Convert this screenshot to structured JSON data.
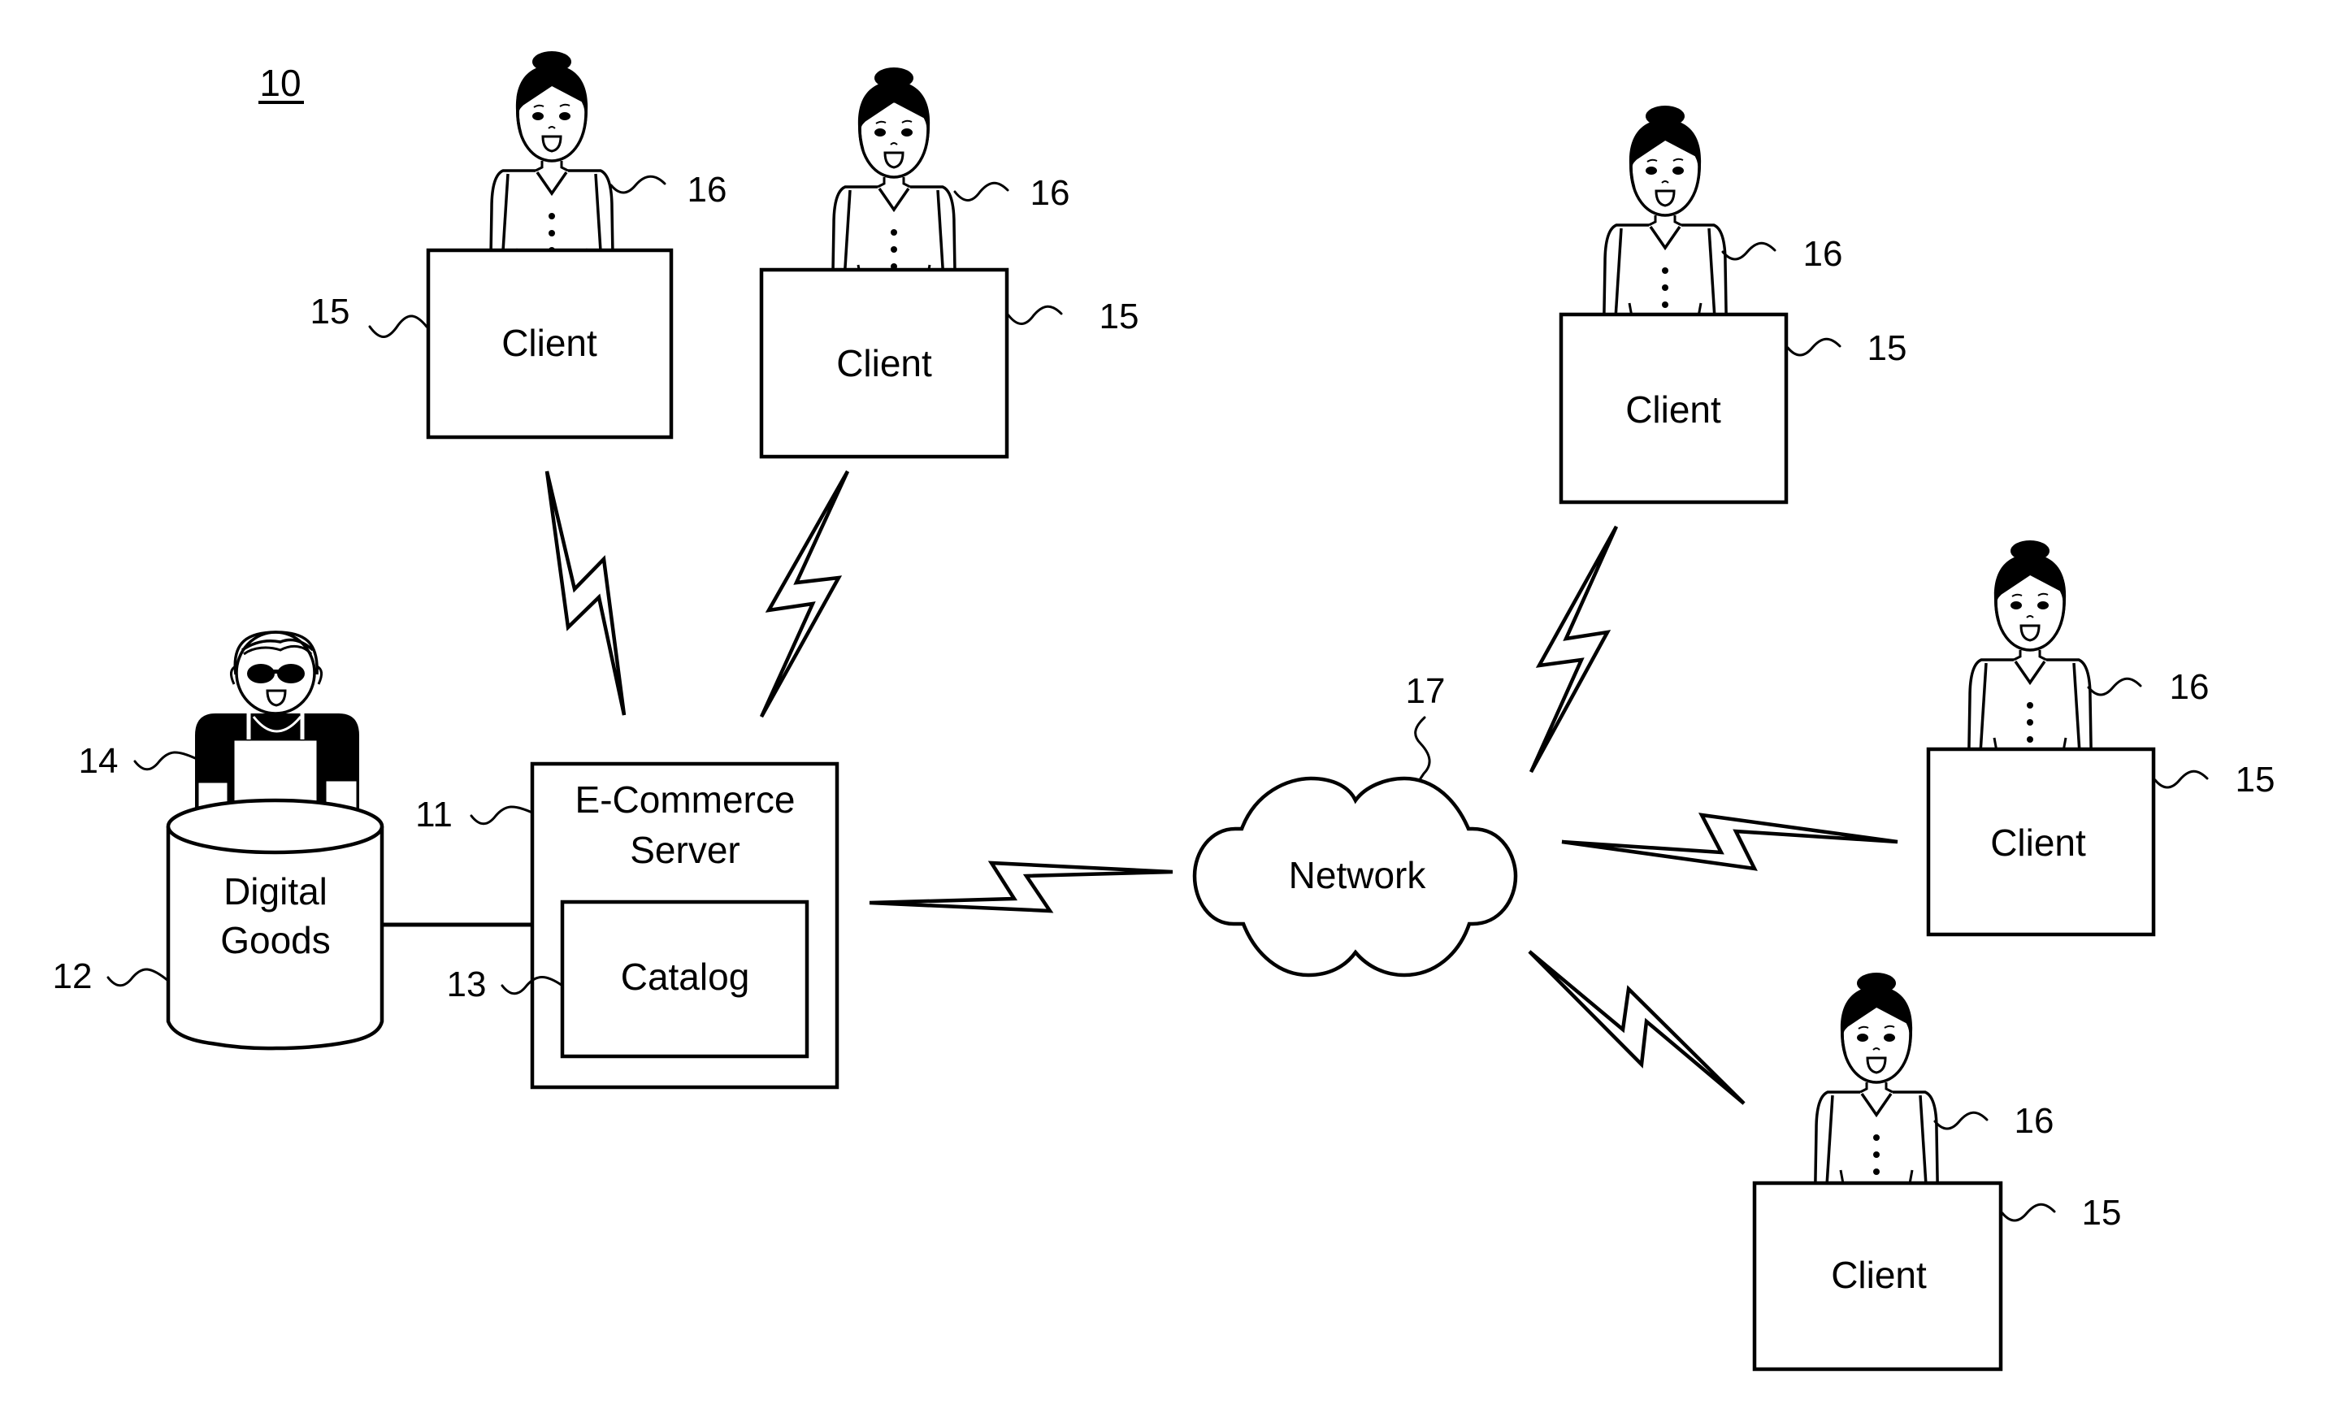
{
  "figure": {
    "number": "10",
    "nodes": {
      "server": {
        "title_line1": "E-Commerce",
        "title_line2": "Server",
        "ref": "11"
      },
      "catalog": {
        "label": "Catalog",
        "ref": "13"
      },
      "storage": {
        "label_line1": "Digital",
        "label_line2": "Goods",
        "ref": "12"
      },
      "merchant": {
        "ref": "14"
      },
      "network": {
        "label": "Network",
        "ref": "17"
      }
    },
    "clients": [
      {
        "label": "Client",
        "box_ref": "15",
        "user_ref": "16"
      },
      {
        "label": "Client",
        "box_ref": "15",
        "user_ref": "16"
      },
      {
        "label": "Client",
        "box_ref": "15",
        "user_ref": "16"
      },
      {
        "label": "Client",
        "box_ref": "15",
        "user_ref": "16"
      },
      {
        "label": "Client",
        "box_ref": "15",
        "user_ref": "16"
      }
    ],
    "connections": [
      {
        "from": "clients.0",
        "to": "server",
        "type": "wireless"
      },
      {
        "from": "clients.1",
        "to": "server",
        "type": "wireless"
      },
      {
        "from": "server",
        "to": "network",
        "type": "wireless"
      },
      {
        "from": "network",
        "to": "clients.2",
        "type": "wireless"
      },
      {
        "from": "network",
        "to": "clients.3",
        "type": "wireless"
      },
      {
        "from": "network",
        "to": "clients.4",
        "type": "wireless"
      },
      {
        "from": "storage",
        "to": "server",
        "type": "wired"
      }
    ]
  }
}
